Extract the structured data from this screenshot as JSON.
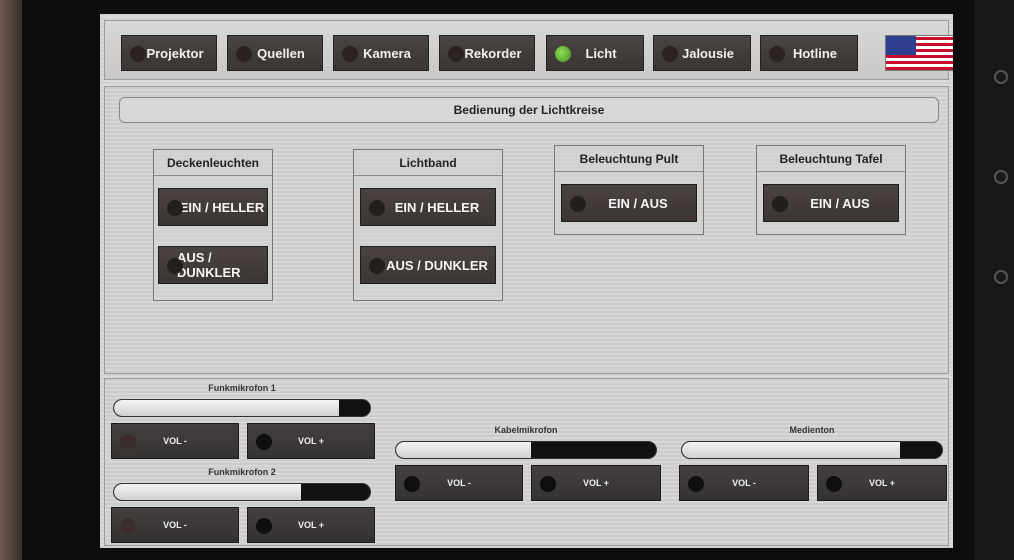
{
  "nav": {
    "items": [
      {
        "label": "Projektor",
        "active": false
      },
      {
        "label": "Quellen",
        "active": false
      },
      {
        "label": "Kamera",
        "active": false
      },
      {
        "label": "Rekorder",
        "active": false
      },
      {
        "label": "Licht",
        "active": true
      },
      {
        "label": "Jalousie",
        "active": false
      },
      {
        "label": "Hotline",
        "active": false
      }
    ],
    "language_flag": "us-flag-icon"
  },
  "light": {
    "title": "Bedienung der Lichtkreise",
    "groups": [
      {
        "title": "Deckenleuchten",
        "buttons": [
          "EIN / HELLER",
          "AUS / DUNKLER"
        ]
      },
      {
        "title": "Lichtband",
        "buttons": [
          "EIN / HELLER",
          "AUS / DUNKLER"
        ]
      },
      {
        "title": "Beleuchtung Pult",
        "buttons": [
          "EIN / AUS"
        ]
      },
      {
        "title": "Beleuchtung Tafel",
        "buttons": [
          "EIN / AUS"
        ]
      }
    ]
  },
  "audio": {
    "channels": [
      {
        "label": "Funkmikrofon 1",
        "level": 0.88,
        "vol_minus": "VOL -",
        "vol_plus": "VOL +"
      },
      {
        "label": "Funkmikrofon 2",
        "level": 0.73,
        "vol_minus": "VOL -",
        "vol_plus": "VOL +"
      },
      {
        "label": "Kabelmikrofon",
        "level": 0.52,
        "vol_minus": "VOL -",
        "vol_plus": "VOL +"
      },
      {
        "label": "Medienton",
        "level": 0.84,
        "vol_minus": "VOL -",
        "vol_plus": "VOL +"
      }
    ]
  },
  "colors": {
    "active_led": "#6cc23a",
    "button_bg": "#3f3a38",
    "panel_bg": "#d2d4d3"
  }
}
